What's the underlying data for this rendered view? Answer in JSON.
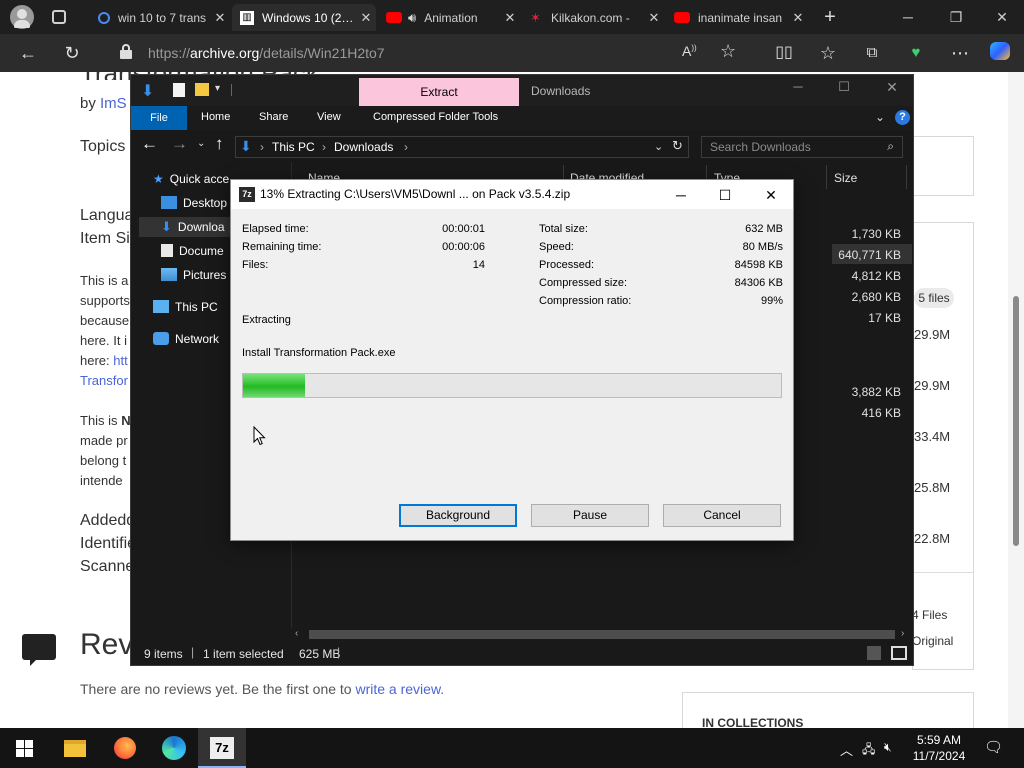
{
  "browser": {
    "tabs": [
      {
        "title": "win 10 to 7 trans",
        "icon": "search-icon"
      },
      {
        "title": "Windows 10 (2…",
        "icon": "archive-icon",
        "active": true
      },
      {
        "title": "Animation",
        "icon": "youtube-icon"
      },
      {
        "title": "Kilkakon.com -",
        "icon": "kilkakon-icon"
      },
      {
        "title": "inanimate insan",
        "icon": "youtube-icon"
      }
    ],
    "url_prefix": "https://",
    "url_host": "archive.org",
    "url_path": "/details/Win21H2to7"
  },
  "webpage": {
    "by_label": "by",
    "author": "ImS",
    "topics": "Topics",
    "language": "Langua",
    "item_size": "Item Si",
    "para1": [
      "This is a",
      "supports",
      "because",
      "here. It i",
      "here:"
    ],
    "para1_link1": "htt",
    "para1_link2": "Transfor",
    "para2_start": "This is",
    "para2_bold": "N",
    "para2": [
      "made pr",
      "belong t",
      "intende"
    ],
    "added": "Addedd",
    "identifier": "Identifie",
    "scanner": "Scanne",
    "reviews_heading": "Rev",
    "no_reviews": "There are no reviews yet. Be the first one to",
    "write_review": "write a review.",
    "collections": "IN COLLECTIONS",
    "side_files": "5 files",
    "side_sizes": [
      "29.9M",
      "29.9M",
      "33.4M",
      "25.8M",
      "22.8M"
    ],
    "side_4files": "4 Files",
    "side_original": "Original"
  },
  "explorer": {
    "extract_tab": "Extract",
    "title": "Downloads",
    "ribbon": [
      "File",
      "Home",
      "Share",
      "View",
      "Compressed Folder Tools"
    ],
    "path": [
      "This PC",
      "Downloads"
    ],
    "search_placeholder": "Search Downloads",
    "columns": [
      "Name",
      "Date modified",
      "Type",
      "Size"
    ],
    "sidebar": [
      "Quick acce",
      "Desktop",
      "Downloa",
      "Docume",
      "Pictures",
      "This PC",
      "Network"
    ],
    "sizes": [
      "1,730 KB",
      "640,771 KB",
      "4,812 KB",
      "2,680 KB",
      "17 KB",
      "3,882 KB",
      "416 KB"
    ],
    "status_items": "9 items",
    "status_selected": "1 item selected",
    "status_size": "625 MB"
  },
  "dialog": {
    "title": "13% Extracting C:\\Users\\VM5\\Downl ... on Pack v3.5.4.zip",
    "icon_text": "7z",
    "elapsed_label": "Elapsed time:",
    "elapsed": "00:00:01",
    "remaining_label": "Remaining time:",
    "remaining": "00:00:06",
    "files_label": "Files:",
    "files": "14",
    "total_size_label": "Total size:",
    "total_size": "632 MB",
    "speed_label": "Speed:",
    "speed": "80 MB/s",
    "processed_label": "Processed:",
    "processed": "84598 KB",
    "compressed_label": "Compressed size:",
    "compressed": "84306 KB",
    "ratio_label": "Compression ratio:",
    "ratio": "99%",
    "status": "Extracting",
    "current_file": "Install Transformation Pack.exe",
    "progress": 0.115,
    "buttons": {
      "background": "Background",
      "pause": "Pause",
      "cancel": "Cancel"
    }
  },
  "taskbar": {
    "time": "5:59 AM",
    "date": "11/7/2024",
    "pinned": [
      "file-explorer-icon",
      "firefox-icon",
      "edge-icon",
      "7zip-icon"
    ],
    "sevenzip_label": "7z"
  },
  "colors": {
    "accent": "#0063b1",
    "extract_tab": "#fbc6dc",
    "progress": "#2fc42f",
    "link": "#4b64d6"
  }
}
